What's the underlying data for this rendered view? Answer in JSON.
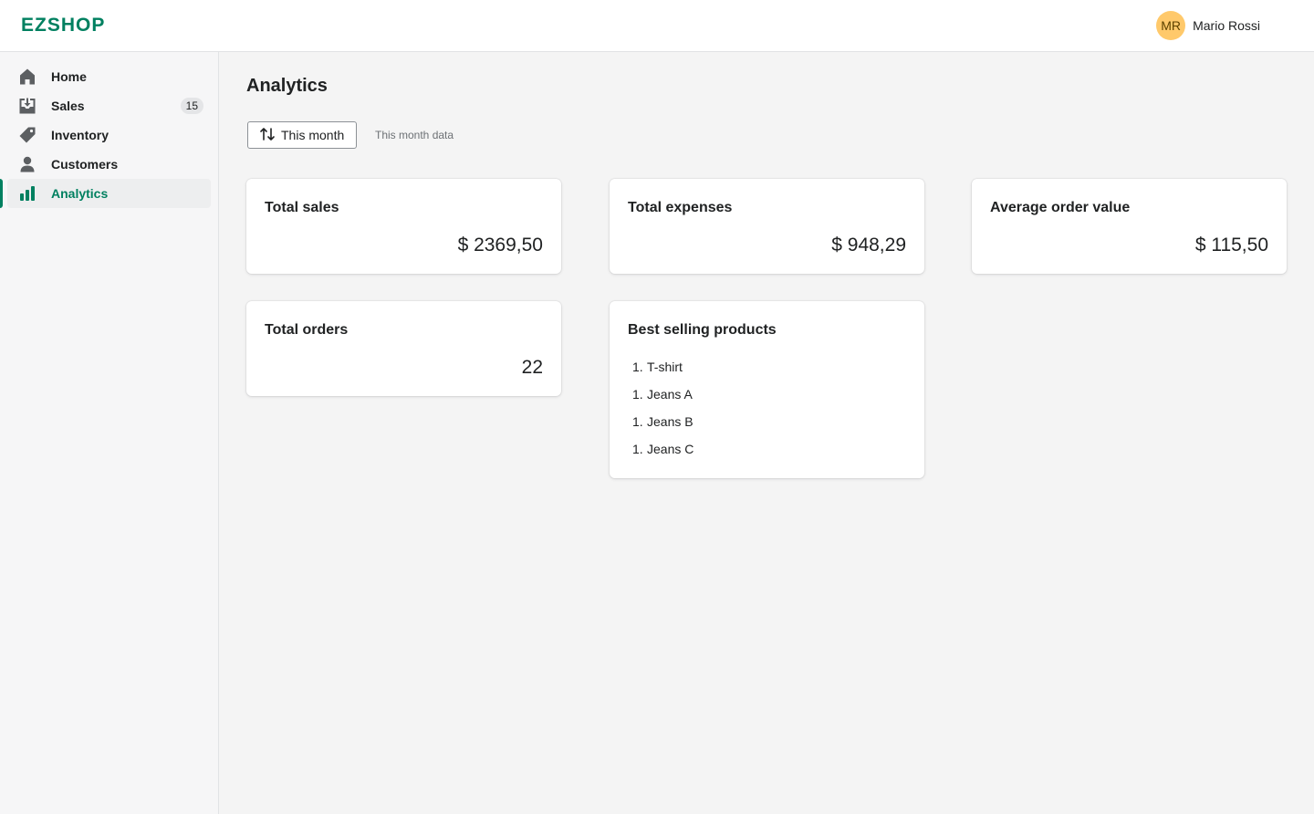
{
  "app": {
    "logo": "EZSHOP"
  },
  "user": {
    "initials": "MR",
    "name": "Mario Rossi"
  },
  "sidebar": {
    "items": [
      {
        "label": "Home",
        "icon": "home-icon"
      },
      {
        "label": "Sales",
        "icon": "sales-icon",
        "badge": "15"
      },
      {
        "label": "Inventory",
        "icon": "tag-icon"
      },
      {
        "label": "Customers",
        "icon": "person-icon"
      },
      {
        "label": "Analytics",
        "icon": "bar-chart-icon",
        "active": true
      }
    ]
  },
  "page": {
    "title": "Analytics",
    "filter": {
      "label": "This month",
      "caption": "This month data",
      "icon": "sort-arrows-icon"
    }
  },
  "cards": {
    "total_sales": {
      "title": "Total sales",
      "value": "$ 2369,50"
    },
    "total_expenses": {
      "title": "Total expenses",
      "value": "$ 948,29"
    },
    "average_order_value": {
      "title": "Average order value",
      "value": "$ 115,50"
    },
    "total_orders": {
      "title": "Total orders",
      "value": "22"
    },
    "best_selling": {
      "title": "Best selling products",
      "items": [
        {
          "num": "1.",
          "name": "T-shirt"
        },
        {
          "num": "1.",
          "name": "Jeans A"
        },
        {
          "num": "1.",
          "name": "Jeans B"
        },
        {
          "num": "1.",
          "name": "Jeans C"
        }
      ]
    }
  },
  "colors": {
    "brand": "#008060",
    "avatar": "#ffc96b",
    "background": "#f4f4f4"
  }
}
